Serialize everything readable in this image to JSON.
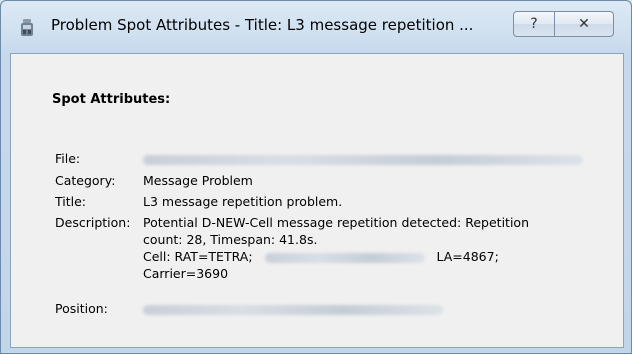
{
  "window": {
    "title": "Problem Spot Attributes - Title: L3 message repetition ...",
    "help_label": "?",
    "close_label": "✕"
  },
  "content": {
    "heading": "Spot Attributes:",
    "labels": {
      "file": "File:",
      "category": "Category:",
      "title": "Title:",
      "description": "Description:",
      "position": "Position:"
    },
    "values": {
      "category": "Message Problem",
      "title": "L3 message repetition problem.",
      "description_line1": "Potential D-NEW-Cell message repetition detected: Repetition",
      "description_line2": "count: 28, Timespan: 41.8s.",
      "cell_prefix": "Cell: RAT=TETRA;",
      "cell_suffix": "LA=4867;",
      "carrier": "Carrier=3690"
    }
  },
  "colors": {
    "window_frame": "#c6d9ec",
    "client_bg": "#f0f0f0"
  }
}
